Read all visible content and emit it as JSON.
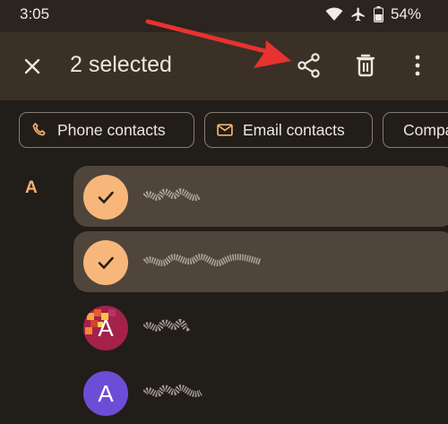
{
  "status": {
    "time": "3:05",
    "battery": "54%"
  },
  "appbar": {
    "title": "2 selected"
  },
  "chips": [
    {
      "label": "Phone contacts"
    },
    {
      "label": "Email contacts"
    },
    {
      "label": "Company"
    }
  ],
  "section": {
    "letter": "A"
  },
  "contacts": [
    {
      "avatar": "",
      "selected": true
    },
    {
      "avatar": "",
      "selected": true
    },
    {
      "avatar": "A",
      "selected": false
    },
    {
      "avatar": "A",
      "selected": false
    }
  ],
  "colors": {
    "background": "#211d19",
    "appbar": "#3a3026",
    "accent": "#f6b26b",
    "selected_row": "#4f453b",
    "arrow": "#e8322f"
  },
  "icons": [
    "wifi-icon",
    "airplane-icon",
    "battery-icon",
    "close-icon",
    "share-icon",
    "delete-icon",
    "more-vert-icon",
    "phone-icon",
    "email-icon",
    "building-icon",
    "check-icon"
  ]
}
